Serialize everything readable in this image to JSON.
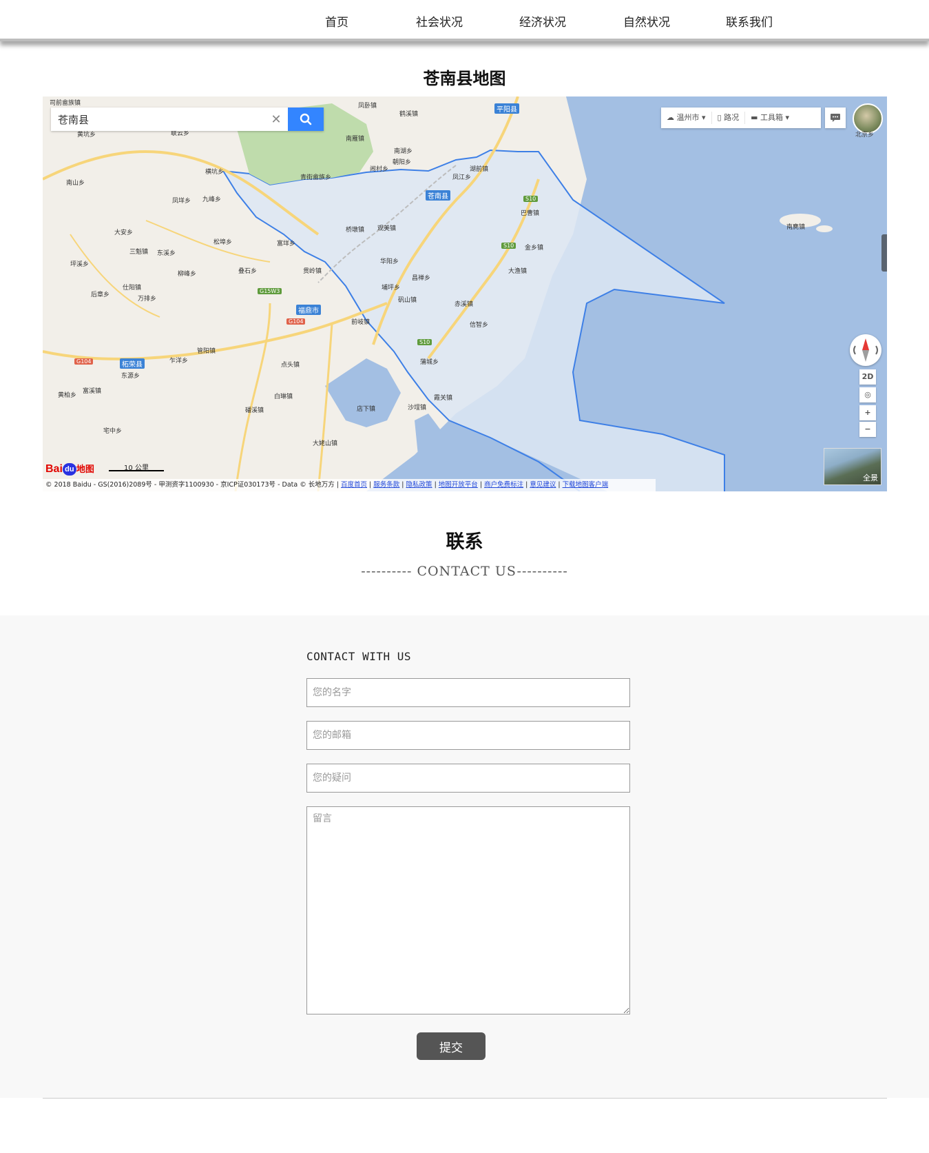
{
  "nav": {
    "items": [
      {
        "label": "首页"
      },
      {
        "label": "社会状况"
      },
      {
        "label": "经济状况"
      },
      {
        "label": "自然状况"
      },
      {
        "label": "联系我们"
      }
    ]
  },
  "map_section": {
    "title": "苍南县地图",
    "search_value": "苍南县",
    "clear_glyph": "✕",
    "tools": {
      "city": "温州市",
      "traffic": "路况",
      "toolbox": "工具箱"
    },
    "avatar_label": "北京乡",
    "ctrl_2d": "2D",
    "ctrl_locate": "◎",
    "ctrl_zoom_in": "+",
    "ctrl_zoom_out": "−",
    "pano_label": "全景",
    "logo": {
      "bai": "Bai",
      "du": "du",
      "dt": "地图"
    },
    "scale": "10 公里",
    "footer_text": "© 2018 Baidu - GS(2016)2089号 - 甲测资字1100930 - 京ICP证030173号 - Data © 长地万方 |",
    "footer_links": [
      "百度首页",
      "服务条款",
      "隐私政策",
      "地图开放平台",
      "商户免费标注",
      "意见建议",
      "下载地图客户端"
    ],
    "place_labels": [
      "凤卧镇",
      "鹤溪镇",
      "平阳县",
      "南雁镇",
      "南湖乡",
      "朝阳乡",
      "闹村乡",
      "湖前镇",
      "凤江乡",
      "横坑乡",
      "青街畲族乡",
      "黄坑乡",
      "联云乡",
      "南山乡",
      "凤垟乡",
      "九峰乡",
      "大安乡",
      "松埠乡",
      "富垟乡",
      "三魁镇",
      "东溪乡",
      "柳峰乡",
      "叠石乡",
      "贯岭镇",
      "桥墩镇",
      "观美镇",
      "巴曹镇",
      "金乡镇",
      "大渔镇",
      "华阳乡",
      "昌禅乡",
      "埔坪乡",
      "矾山镇",
      "赤溪镇",
      "信智乡",
      "前岐镇",
      "点头镇",
      "蒲城乡",
      "霞关镇",
      "沙埕镇",
      "店下镇",
      "白琳镇",
      "磻溪镇",
      "大姥山镇",
      "宅中乡",
      "东源乡",
      "乍洋乡",
      "管阳镇",
      "仕阳镇",
      "万排乡",
      "后章乡",
      "坪溪乡",
      "黄柏乡",
      "富溪镇",
      "南麂镇",
      "司前畲族镇"
    ],
    "city_labels": [
      "苍南县",
      "福鼎市",
      "柘荣县"
    ],
    "road_labels": [
      "S10",
      "S10",
      "S10",
      "G15W3",
      "G104",
      "G104"
    ]
  },
  "contact": {
    "title": "联系",
    "subtitle": "---------- CONTACT US----------",
    "form_heading": "CONTACT WITH US",
    "name_placeholder": "您的名字",
    "email_placeholder": "您的邮箱",
    "question_placeholder": "您的疑问",
    "message_placeholder": "留言",
    "submit_label": "提交"
  },
  "colors": {
    "sea": "#a3bfe3",
    "land": "#f2efe9",
    "highlight": "#dde6f3",
    "boundary": "#3d7fe6",
    "forest": "#bfdcac",
    "road": "#f7d57a",
    "search_button": "#3385ff",
    "submit_bg": "#555555",
    "form_bg": "#f8f8f8"
  }
}
